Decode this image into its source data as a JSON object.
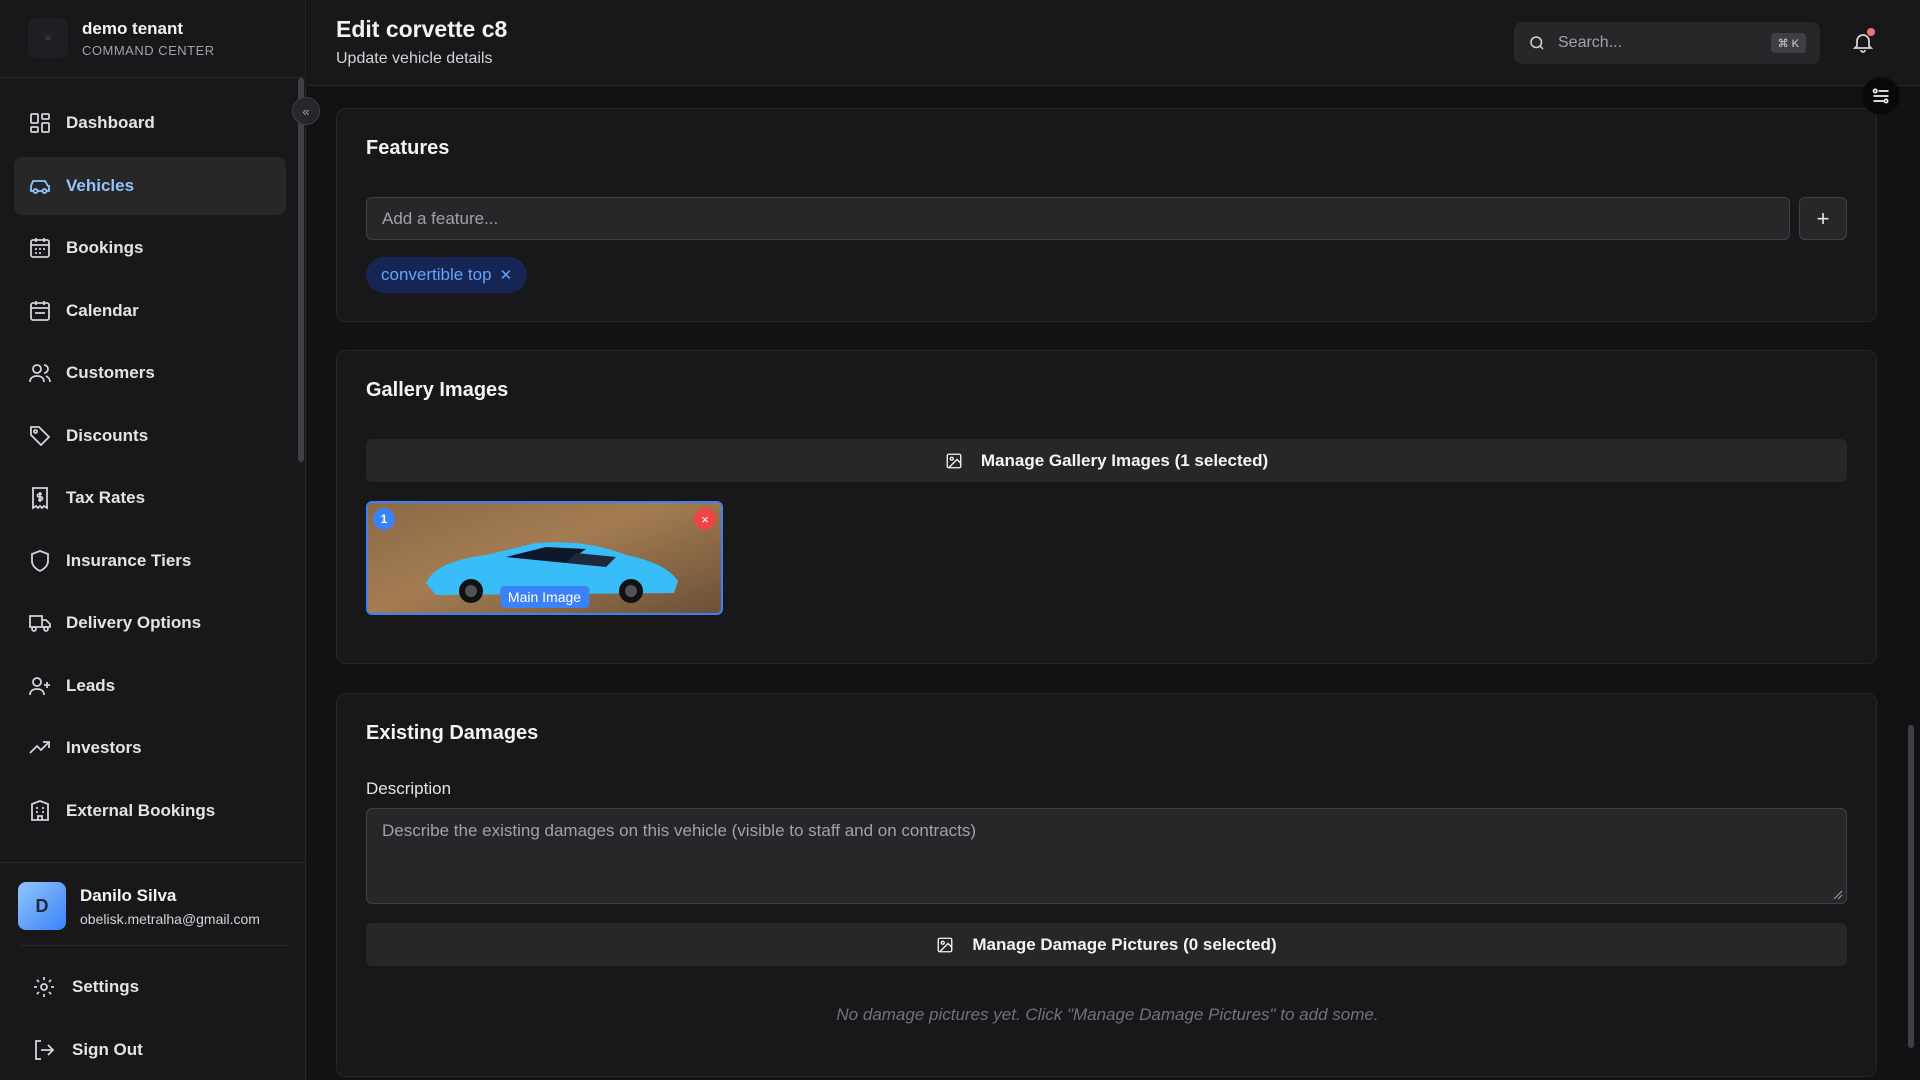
{
  "brand": {
    "name": "demo tenant",
    "subtitle": "COMMAND CENTER"
  },
  "sidebar": {
    "items": [
      {
        "label": "Dashboard",
        "icon": "dashboard-icon"
      },
      {
        "label": "Vehicles",
        "icon": "car-icon",
        "active": true
      },
      {
        "label": "Bookings",
        "icon": "calendar-grid-icon"
      },
      {
        "label": "Calendar",
        "icon": "calendar-icon"
      },
      {
        "label": "Customers",
        "icon": "users-icon"
      },
      {
        "label": "Discounts",
        "icon": "tag-icon"
      },
      {
        "label": "Tax Rates",
        "icon": "receipt-icon"
      },
      {
        "label": "Insurance Tiers",
        "icon": "shield-icon"
      },
      {
        "label": "Delivery Options",
        "icon": "truck-icon"
      },
      {
        "label": "Leads",
        "icon": "user-plus-icon"
      },
      {
        "label": "Investors",
        "icon": "trending-up-icon"
      },
      {
        "label": "External Bookings",
        "icon": "building-icon"
      }
    ],
    "active_color": "#93c5fd"
  },
  "user": {
    "initial": "D",
    "name": "Danilo Silva",
    "email": "obelisk.metralha@gmail.com"
  },
  "bottom": {
    "settings": "Settings",
    "sign_out": "Sign Out"
  },
  "header": {
    "title": "Edit corvette c8",
    "subtitle": "Update vehicle details",
    "search_placeholder": "Search...",
    "search_shortcut": "⌘ K"
  },
  "features": {
    "title": "Features",
    "input_placeholder": "Add a feature...",
    "add_label": "+",
    "tags": [
      "convertible top"
    ]
  },
  "gallery": {
    "title": "Gallery Images",
    "manage_label": "Manage Gallery Images (1 selected)",
    "images": [
      {
        "index": "1",
        "label": "Main Image",
        "remove": "×"
      }
    ]
  },
  "damages": {
    "title": "Existing Damages",
    "description_label": "Description",
    "description_placeholder": "Describe the existing damages on this vehicle (visible to staff and on contracts)",
    "manage_label": "Manage Damage Pictures (0 selected)",
    "empty_text": "No damage pictures yet. Click \"Manage Damage Pictures\" to add some."
  },
  "colors": {
    "accent": "#3b82f6",
    "background": "#121214",
    "danger": "#ef4444"
  }
}
